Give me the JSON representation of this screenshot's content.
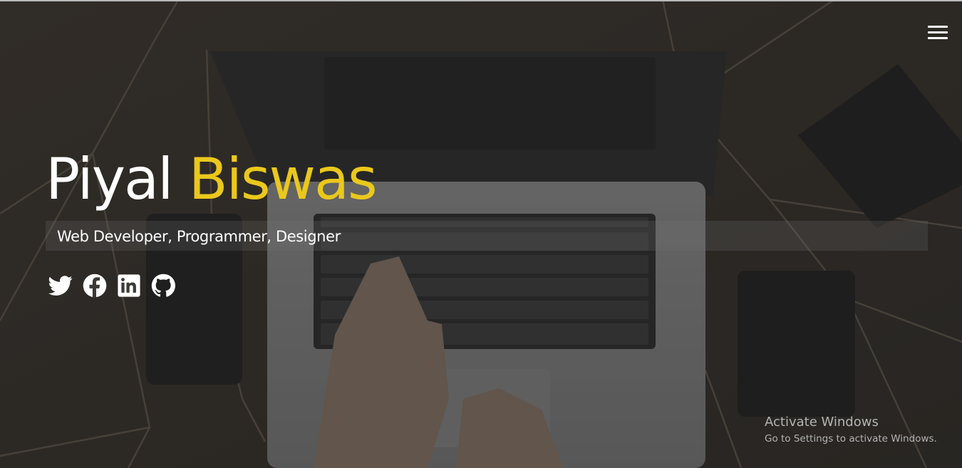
{
  "profile": {
    "first_name": "Piyal",
    "last_name": "Biswas",
    "tagline": "Web Developer, Programmer, Designer"
  },
  "nav": {
    "menu_icon": "hamburger-menu-icon"
  },
  "social_links": [
    {
      "icon": "twitter-icon",
      "network": "Twitter"
    },
    {
      "icon": "facebook-icon",
      "network": "Facebook"
    },
    {
      "icon": "linkedin-icon",
      "network": "LinkedIn"
    },
    {
      "icon": "github-icon",
      "network": "GitHub"
    }
  ],
  "windows_watermark": {
    "title": "Activate Windows",
    "subtitle": "Go to Settings to activate Windows."
  },
  "colors": {
    "accent": "#eac81c",
    "text": "#ffffff",
    "overlay": "#2b2b2b"
  }
}
